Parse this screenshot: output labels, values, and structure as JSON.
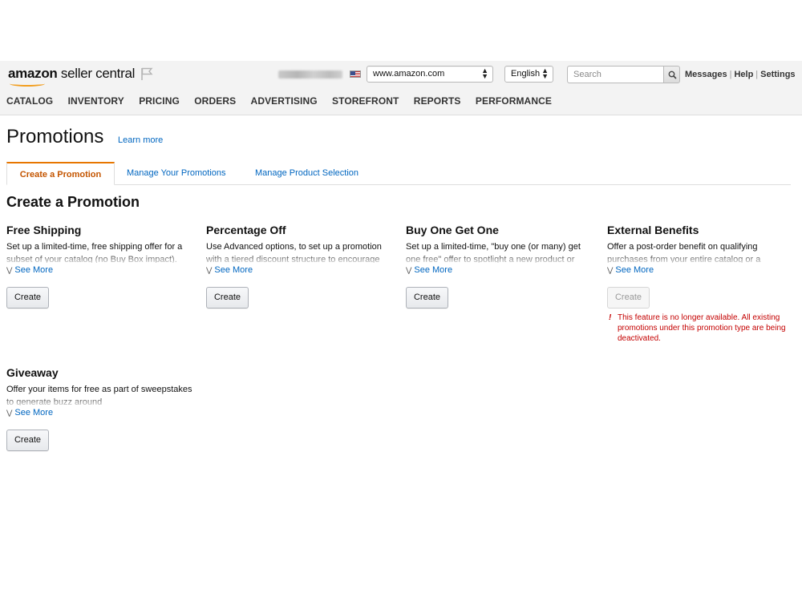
{
  "header": {
    "logo_brand": "amazon",
    "logo_product": " seller central",
    "marketplace": "www.amazon.com",
    "language": "English",
    "search_placeholder": "Search",
    "links": [
      "Messages",
      "Help",
      "Settings"
    ]
  },
  "nav": {
    "items": [
      "CATALOG",
      "INVENTORY",
      "PRICING",
      "ORDERS",
      "ADVERTISING",
      "STOREFRONT",
      "REPORTS",
      "PERFORMANCE"
    ]
  },
  "page": {
    "title": "Promotions",
    "learn_more": "Learn more"
  },
  "tabs": [
    {
      "label": "Create a Promotion",
      "active": true
    },
    {
      "label": "Manage Your Promotions",
      "active": false
    },
    {
      "label": "Manage Product Selection",
      "active": false
    }
  ],
  "section": {
    "title": "Create a Promotion"
  },
  "promotions": [
    {
      "title": "Free Shipping",
      "description": "Set up a limited-time, free shipping offer for a subset of your catalog (no Buy Box impact).",
      "see_more": "See More",
      "button": "Create"
    },
    {
      "title": "Percentage Off",
      "description": "Use Advanced options, to set up a promotion with a tiered discount structure to encourage",
      "see_more": "See More",
      "button": "Create"
    },
    {
      "title": "Buy One Get One",
      "description": "Set up a limited-time, \"buy one (or many) get one free\" offer to spotlight a new product or",
      "see_more": "See More",
      "button": "Create"
    },
    {
      "title": "External Benefits",
      "description": "Offer a post-order benefit on qualifying purchases from your entire catalog or a",
      "see_more": "See More",
      "button": "Create",
      "warning": "This feature is no longer available. All existing promotions under this promotion type are being deactivated."
    },
    {
      "title": "Giveaway",
      "description": "Offer your items for free as part of sweepstakes to generate buzz around",
      "see_more": "See More",
      "button": "Create"
    }
  ],
  "colors": {
    "link": "#0066c0",
    "active_tab_text": "#c45500",
    "active_tab_accent": "#e77600",
    "warning": "#c40000",
    "header_bg": "#f3f3f3"
  }
}
